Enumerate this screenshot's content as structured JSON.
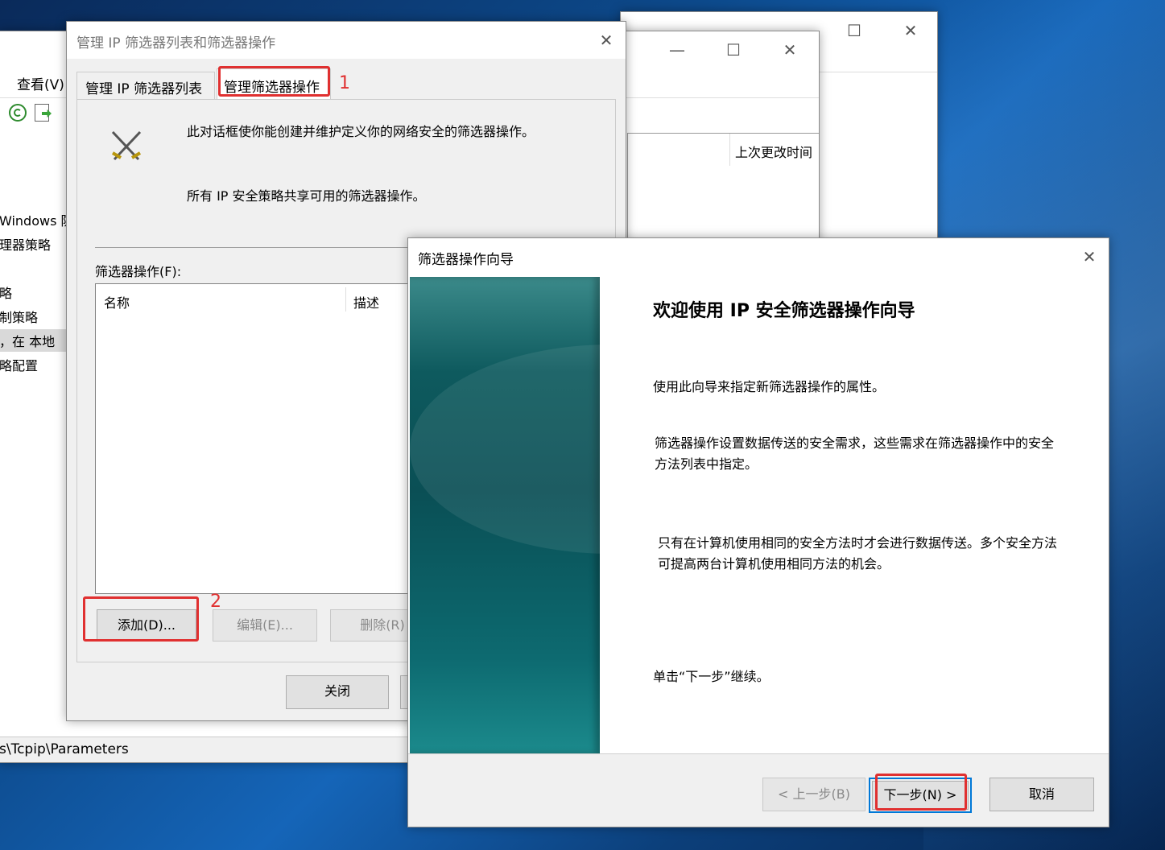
{
  "mmc": {
    "menu_view": "查看(V)",
    "tree_items": [
      "Windows 防",
      "理器策略",
      "略",
      "制策略",
      "，在 本地",
      "略配置"
    ],
    "column_last_modified": "上次更改时间",
    "status_path": "s\\Tcpip\\Parameters"
  },
  "manage_dialog": {
    "title": "管理 IP 筛选器列表和筛选器操作",
    "tab_filter_lists": "管理 IP 筛选器列表",
    "tab_filter_actions": "管理筛选器操作",
    "description_1": "此对话框使你能创建并维护定义你的网络安全的筛选器操作。",
    "description_2": "所有 IP 安全策略共享可用的筛选器操作。",
    "filter_actions_label": "筛选器操作(F):",
    "col_name": "名称",
    "col_desc": "描述",
    "add_button": "添加(D)...",
    "edit_button": "编辑(E)...",
    "delete_button": "删除(R)",
    "close_button": "关闭"
  },
  "wizard": {
    "title": "筛选器操作向导",
    "heading": "欢迎使用 IP 安全筛选器操作向导",
    "para1": "使用此向导来指定新筛选器操作的属性。",
    "para2": "筛选器操作设置数据传送的安全需求，这些需求在筛选器操作中的安全方法列表中指定。",
    "para3": "只有在计算机使用相同的安全方法时才会进行数据传送。多个安全方法可提高两台计算机使用相同方法的机会。",
    "para4": "单击“下一步”继续。",
    "back_button": "< 上一步(B)",
    "next_button": "下一步(N) >",
    "cancel_button": "取消"
  },
  "annotations": {
    "step1": "1",
    "step2": "2"
  },
  "colors": {
    "annotation_red": "#e03030",
    "wizard_banner": "#0e5a5e",
    "focus_blue": "#0078d7"
  },
  "icons": [
    "refresh-icon",
    "export-icon",
    "crossed-swords-icon",
    "close-icon",
    "minimize-icon",
    "maximize-icon"
  ]
}
